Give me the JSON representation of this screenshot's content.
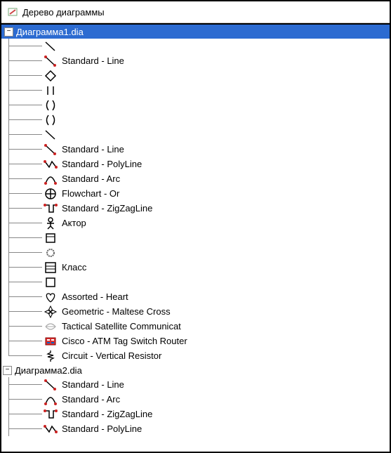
{
  "window": {
    "title": "Дерево диаграммы"
  },
  "tree": [
    {
      "name": "Диаграмма1.dia",
      "expanded": true,
      "selected": true,
      "children": [
        {
          "icon": "line",
          "label": ""
        },
        {
          "icon": "line-red",
          "label": "Standard - Line"
        },
        {
          "icon": "diamond",
          "label": ""
        },
        {
          "icon": "flip",
          "label": ""
        },
        {
          "icon": "parens",
          "label": ""
        },
        {
          "icon": "parens",
          "label": ""
        },
        {
          "icon": "line",
          "label": ""
        },
        {
          "icon": "line-red",
          "label": "Standard - Line"
        },
        {
          "icon": "polyline",
          "label": "Standard - PolyLine"
        },
        {
          "icon": "arc",
          "label": "Standard - Arc"
        },
        {
          "icon": "or",
          "label": "Flowchart - Or"
        },
        {
          "icon": "zigzag",
          "label": "Standard - ZigZagLine"
        },
        {
          "icon": "actor",
          "label": "Актор"
        },
        {
          "icon": "box",
          "label": ""
        },
        {
          "icon": "gear",
          "label": ""
        },
        {
          "icon": "class",
          "label": "Класс"
        },
        {
          "icon": "box",
          "label": ""
        },
        {
          "icon": "heart",
          "label": "Assorted - Heart"
        },
        {
          "icon": "maltese",
          "label": "Geometric - Maltese Cross"
        },
        {
          "icon": "satcom",
          "label": "Tactical Satellite Communicat"
        },
        {
          "icon": "cisco",
          "label": "Cisco - ATM Tag Switch Router"
        },
        {
          "icon": "resistor",
          "label": "Circuit - Vertical Resistor"
        }
      ]
    },
    {
      "name": "Диаграмма2.dia",
      "expanded": true,
      "selected": false,
      "children": [
        {
          "icon": "line-red",
          "label": "Standard - Line"
        },
        {
          "icon": "arc",
          "label": "Standard - Arc"
        },
        {
          "icon": "zigzag",
          "label": "Standard - ZigZagLine"
        },
        {
          "icon": "polyline",
          "label": "Standard - PolyLine"
        }
      ]
    }
  ],
  "expander": {
    "collapse": "−",
    "expand": "+"
  }
}
